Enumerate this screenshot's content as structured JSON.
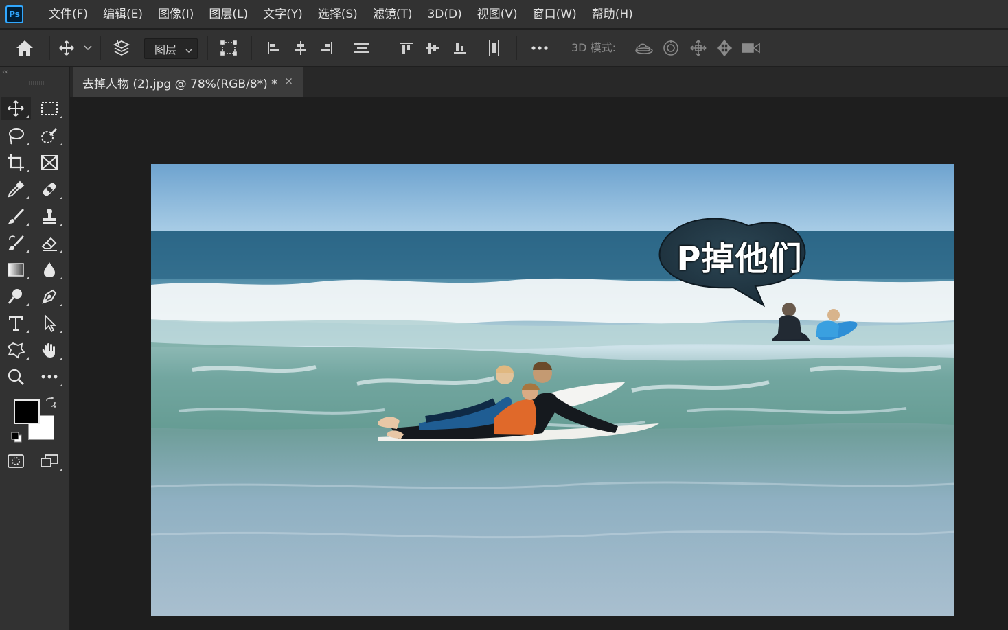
{
  "app": {
    "logo_text": "Ps",
    "accent_color": "#31a8ff"
  },
  "menu": [
    "文件(F)",
    "编辑(E)",
    "图像(I)",
    "图层(L)",
    "文字(Y)",
    "选择(S)",
    "滤镜(T)",
    "3D(D)",
    "视图(V)",
    "窗口(W)",
    "帮助(H)"
  ],
  "options_bar": {
    "auto_select_target": "图层",
    "mode_label": "3D 模式:",
    "icons": [
      "home-icon",
      "move-icon",
      "auto-select-layers-icon",
      "show-transform-controls-icon",
      "align-left-icon",
      "align-horizontal-center-icon",
      "align-right-icon",
      "distribute-vertical-icon",
      "align-top-icon",
      "align-vertical-center-icon",
      "align-bottom-icon",
      "distribute-horizontal-icon",
      "more-options-icon",
      "orbit-3d-icon",
      "roll-3d-icon",
      "pan-3d-icon",
      "slide-3d-icon",
      "scale-3d-icon"
    ]
  },
  "toolbar": {
    "collapse_label": "‹‹",
    "tools": [
      "move-tool",
      "rectangular-marquee-tool",
      "lasso-tool",
      "quick-selection-tool",
      "crop-tool",
      "frame-tool",
      "eyedropper-tool",
      "spot-healing-brush-tool",
      "brush-tool",
      "clone-stamp-tool",
      "history-brush-tool",
      "eraser-tool",
      "gradient-tool",
      "blur-tool",
      "dodge-tool",
      "pen-tool",
      "type-tool",
      "path-selection-tool",
      "custom-shape-tool",
      "hand-tool",
      "zoom-tool",
      "edit-toolbar"
    ],
    "foreground_color": "#000000",
    "background_color": "#ffffff"
  },
  "document": {
    "tab_title": "去掉人物 (2).jpg @ 78%(RGB/8*) *",
    "close_label": "×"
  },
  "canvas": {
    "speech_bubble_text": "P掉他们"
  }
}
